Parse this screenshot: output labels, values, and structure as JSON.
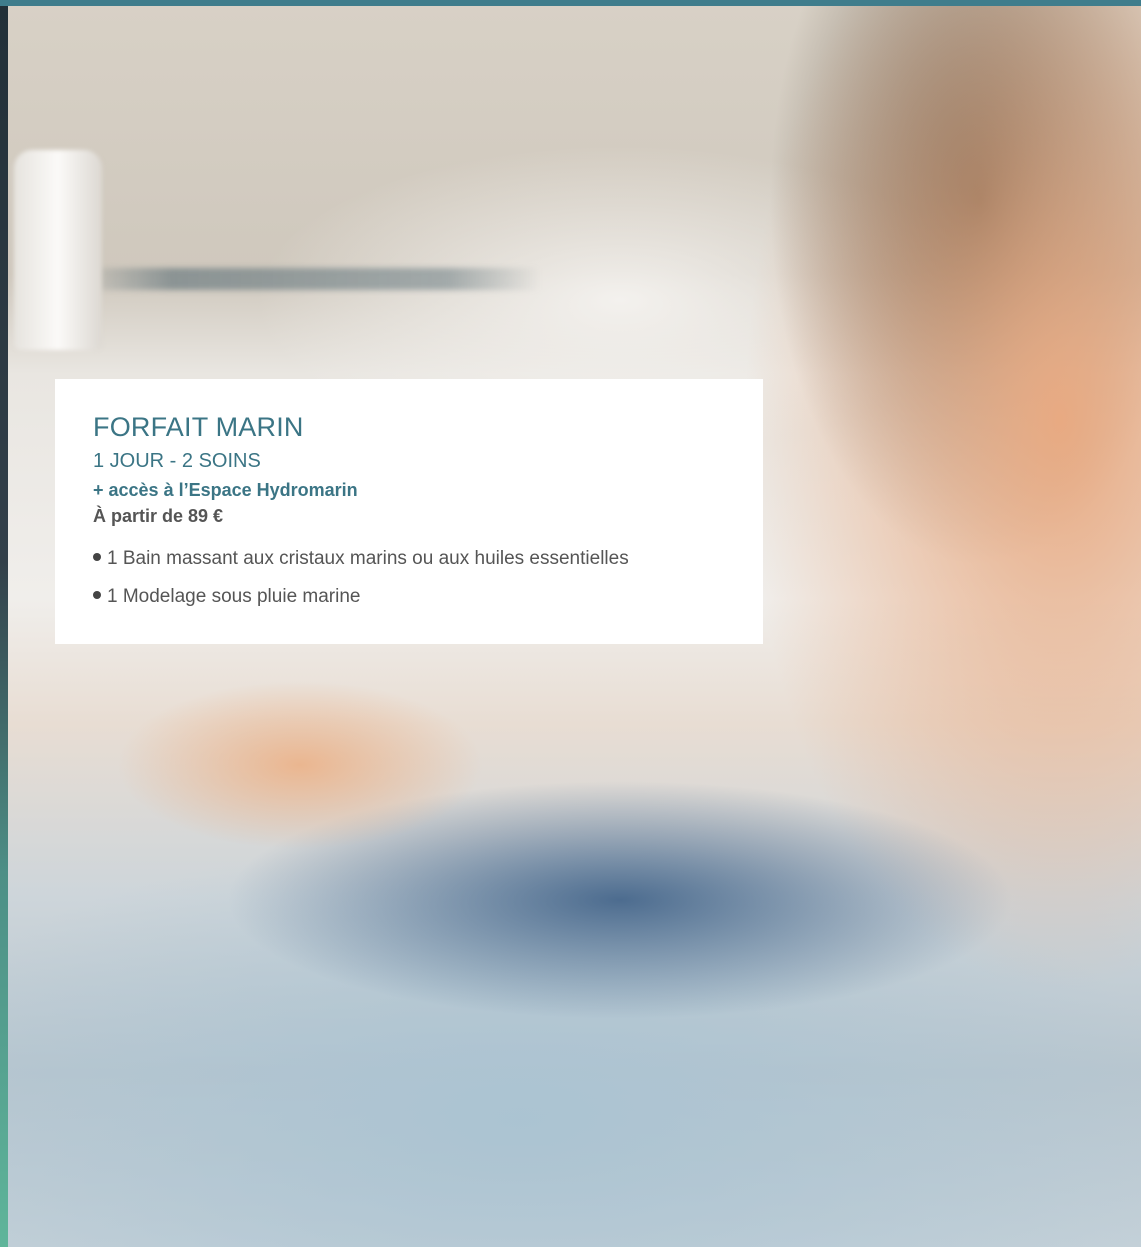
{
  "offer": {
    "title": "FORFAIT MARIN",
    "subtitle": "1 JOUR - 2 SOINS",
    "access": "+ accès à l’Espace Hydromarin",
    "price": "À partir de 89 €",
    "items": [
      "1 Bain massant aux cristaux marins ou aux huiles essentielles",
      "1 Modelage sous pluie marine"
    ]
  },
  "colors": {
    "accent": "#3b7585",
    "body_text": "#555555",
    "card_background": "#ffffff"
  }
}
